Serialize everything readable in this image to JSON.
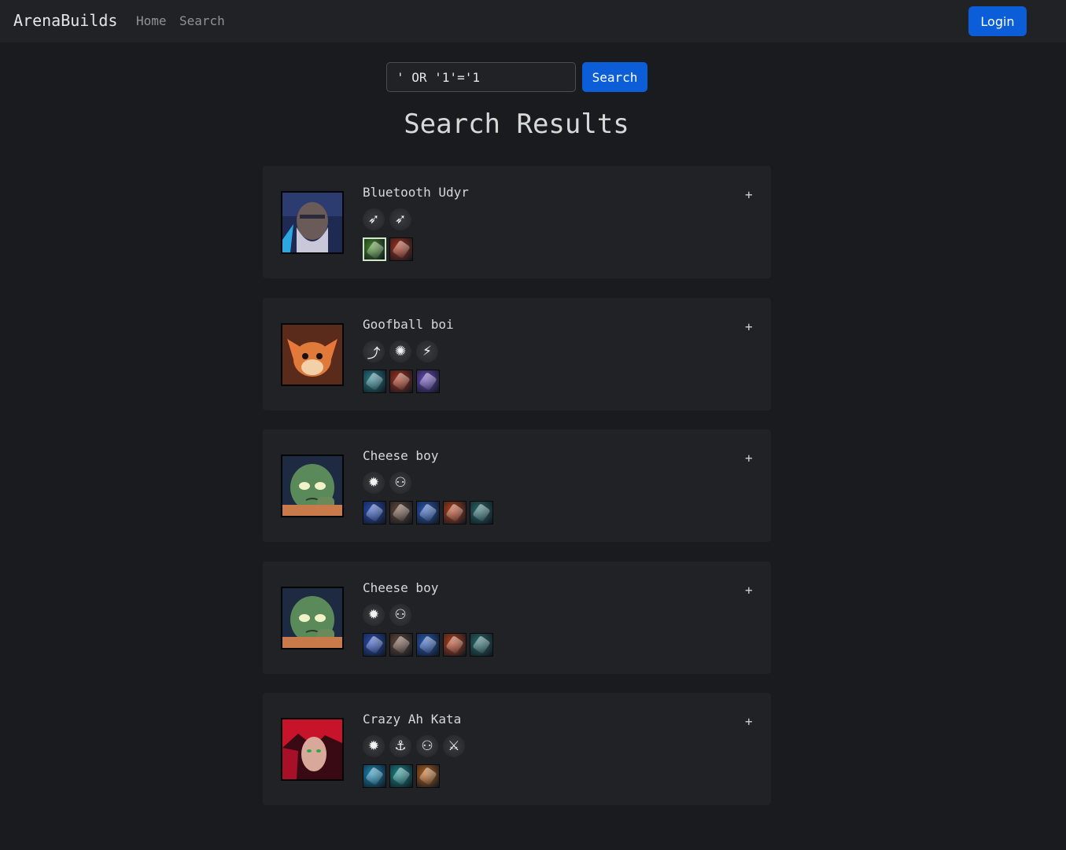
{
  "navbar": {
    "brand": "ArenaBuilds",
    "links": [
      "Home",
      "Search"
    ],
    "login_label": "Login"
  },
  "search": {
    "value": "' OR '1'='1",
    "button_label": "Search"
  },
  "page_title": "Search Results",
  "builds": [
    {
      "name": "Bluetooth Udyr",
      "champion": "udyr",
      "plus": "+",
      "augments": [
        "bow-arrow-icon",
        "bow-arrow-icon"
      ],
      "items": [
        "#4a8c2a",
        "#a8321a"
      ]
    },
    {
      "name": "Goofball boi",
      "champion": "gnar",
      "plus": "+",
      "augments": [
        "split-arrow-icon",
        "gear-burst-icon",
        "claw-icon"
      ],
      "items": [
        "#2a7e8a",
        "#a8321a",
        "#6a4ab8"
      ]
    },
    {
      "name": "Cheese boy",
      "champion": "amumu",
      "plus": "+",
      "augments": [
        "gear-icon",
        "people-icon"
      ],
      "items": [
        "#2a4eb8",
        "#6a4a3a",
        "#2a5ab8",
        "#b8421a",
        "#2a6a6a"
      ]
    },
    {
      "name": "Cheese boy",
      "champion": "amumu",
      "plus": "+",
      "augments": [
        "gear-icon",
        "people-icon"
      ],
      "items": [
        "#2a4eb8",
        "#6a4a3a",
        "#2a5ab8",
        "#b8421a",
        "#2a6a6a"
      ]
    },
    {
      "name": "Crazy Ah Kata",
      "champion": "katarina",
      "plus": "+",
      "augments": [
        "gear-icon",
        "anchor-gear-icon",
        "people-icon",
        "sword-icon"
      ],
      "items": [
        "#1a8ab8",
        "#1a8a8a",
        "#b8621a"
      ]
    }
  ],
  "colors": {
    "background": "#1a1b1e",
    "card": "#212226",
    "accent": "#0b5ed7"
  }
}
